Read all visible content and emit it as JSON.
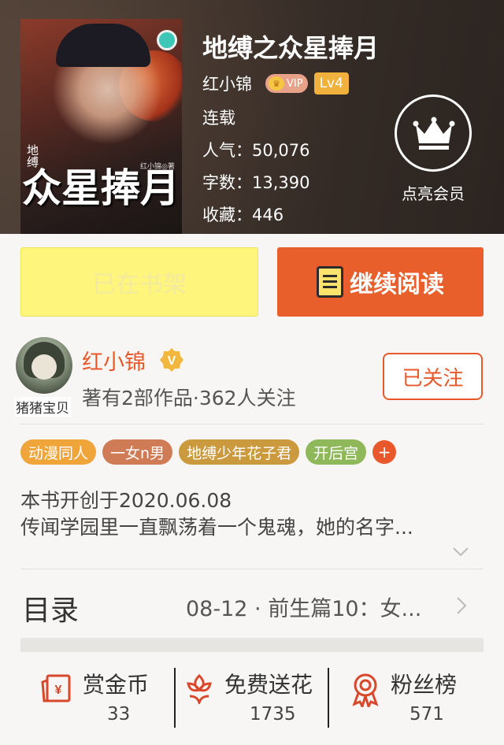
{
  "book": {
    "title": "地缚之众星捧月",
    "cover_title": "众星捧月",
    "cover_small": "地缚",
    "cover_author": "红小锦◎著",
    "author": "红小锦",
    "vip_label": "VIP",
    "level_label": "Lv4",
    "status": "连载",
    "popularity": "人气：50,076",
    "word_count": "字数：13,390",
    "favorites": "收藏：446"
  },
  "member": {
    "label": "点亮会员"
  },
  "actions": {
    "shelf_label": "已在书架",
    "read_label": "继续阅读"
  },
  "author_card": {
    "name": "红小锦",
    "avatar_caption": "猪猪宝贝",
    "meta": "著有2部作品·362人关注",
    "follow_label": "已关注"
  },
  "tags": [
    {
      "label": "动漫同人",
      "color": "#f0a53a"
    },
    {
      "label": "一女n男",
      "color": "#cf7b55"
    },
    {
      "label": "地缚少年花子君",
      "color": "#cc9a3e"
    },
    {
      "label": "开后宫",
      "color": "#8fb85a"
    }
  ],
  "tag_more": "+",
  "description": {
    "line1": "本书开创于2020.06.08",
    "line2": "传闻学园里一直飘荡着一个鬼魂，她的名字..."
  },
  "toc": {
    "label": "目录",
    "latest": "08-12 · 前生篇10：女..."
  },
  "stats": {
    "coins": {
      "label": "赏金币",
      "value": "33"
    },
    "flowers": {
      "label": "免费送花",
      "value": "1735"
    },
    "fans": {
      "label": "粉丝榜",
      "value": "571"
    }
  },
  "colors": {
    "accent": "#e8582a",
    "read_button": "#e95f2c",
    "shelf_button": "#fdf57c",
    "level_badge": "#f0b23c"
  }
}
